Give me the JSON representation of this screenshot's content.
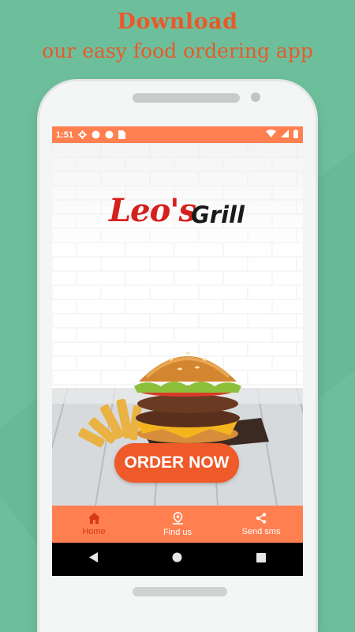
{
  "promo": {
    "line1": "Download",
    "line2": "our easy food ordering app"
  },
  "status_bar": {
    "time": "1:51",
    "left_icons": [
      "gear-icon",
      "circle-icon",
      "circle-icon",
      "sim-icon"
    ],
    "right_icons": [
      "wifi-icon",
      "signal-icon",
      "battery-icon"
    ]
  },
  "brand": {
    "logo_text_1": "Leo's",
    "logo_text_2": "Grill"
  },
  "hero": {
    "order_button": "ORDER NOW"
  },
  "bottom_nav": [
    {
      "label": "Home",
      "icon": "home-icon",
      "active": true
    },
    {
      "label": "Find us",
      "icon": "location-icon",
      "active": false
    },
    {
      "label": "Send sms",
      "icon": "share-icon",
      "active": false
    }
  ],
  "colors": {
    "background": "#6dbf9c",
    "accent": "#ff7f50",
    "button": "#ee5a2a",
    "headline": "#e8592b",
    "active_nav": "#d53a18"
  }
}
